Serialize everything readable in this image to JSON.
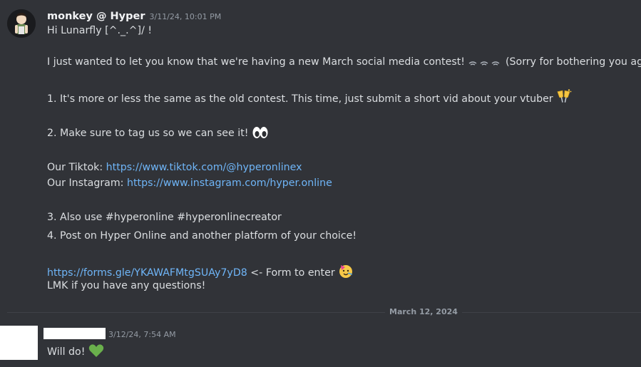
{
  "message1": {
    "username": "monkey @ Hyper",
    "timestamp": "3/11/24, 10:01 PM",
    "greeting": "Hi Lunarfly [^._.^]/ !",
    "contest_intro": "I just wanted to let you know that we're having a new March social media contest!",
    "contest_apology": "(Sorry for bothering you again)",
    "point1": "1. It's more or less the same as the old contest. This time, just submit a short vid about your vtuber",
    "point2": "2. Make sure to tag us so we can see it!",
    "tiktok_label": "Our Tiktok:",
    "tiktok_url": "https://www.tiktok.com/@hyperonlinex",
    "instagram_label": "Our Instagram:",
    "instagram_url": "https://www.instagram.com/hyper.online",
    "point3": "3. Also use #hyperonline #hyperonlinecreator",
    "point4": "4. Post on Hyper Online and another platform of your choice!",
    "form_url": "https://forms.gle/YKAWAFMtgSUAy7yD8",
    "form_suffix": "<- Form to enter",
    "closing": "LMK if you have any questions!"
  },
  "date_divider": "March 12, 2024",
  "message2": {
    "timestamp": "3/12/24, 7:54 AM",
    "text": "Will do!"
  },
  "icons": {
    "avatar1": "anime-character-avatar",
    "sparkle_emoji": "sparkles-emoji",
    "cheers_emoji": "clinking-glasses-emoji",
    "eyes_emoji": "eyes-emoji",
    "party_emoji": "partying-face-emoji",
    "heart_emoji": "green-heart-emoji"
  },
  "colors": {
    "background": "#313338",
    "text": "#dbdee1",
    "link": "#6fb5f7",
    "muted": "#949ba4",
    "heart": "#6ab04c"
  }
}
